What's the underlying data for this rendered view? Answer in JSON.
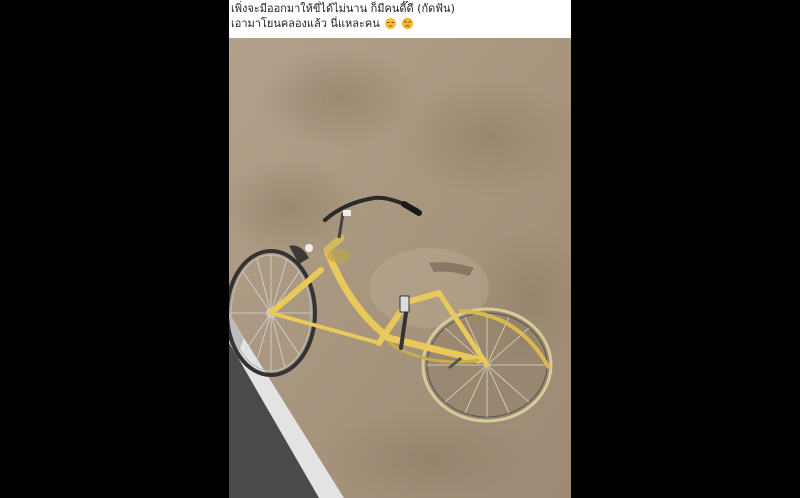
{
  "post": {
    "caption_line1": "เพิ่งจะมีออกมาให้ขี่ได้ไม่นาน ก็มีคนดี๊ดี (กัดฟัน)",
    "caption_line2": "เอามาโยนคลองแล้ว นี่แหละคน",
    "emojis": [
      "unamused-face-icon",
      "angry-face-icon"
    ]
  },
  "photo": {
    "subject": "bicycle-in-water",
    "colors": {
      "water": "#a8957e",
      "bike_frame": "#e9c95a",
      "wall": "#d8d8d8"
    }
  }
}
